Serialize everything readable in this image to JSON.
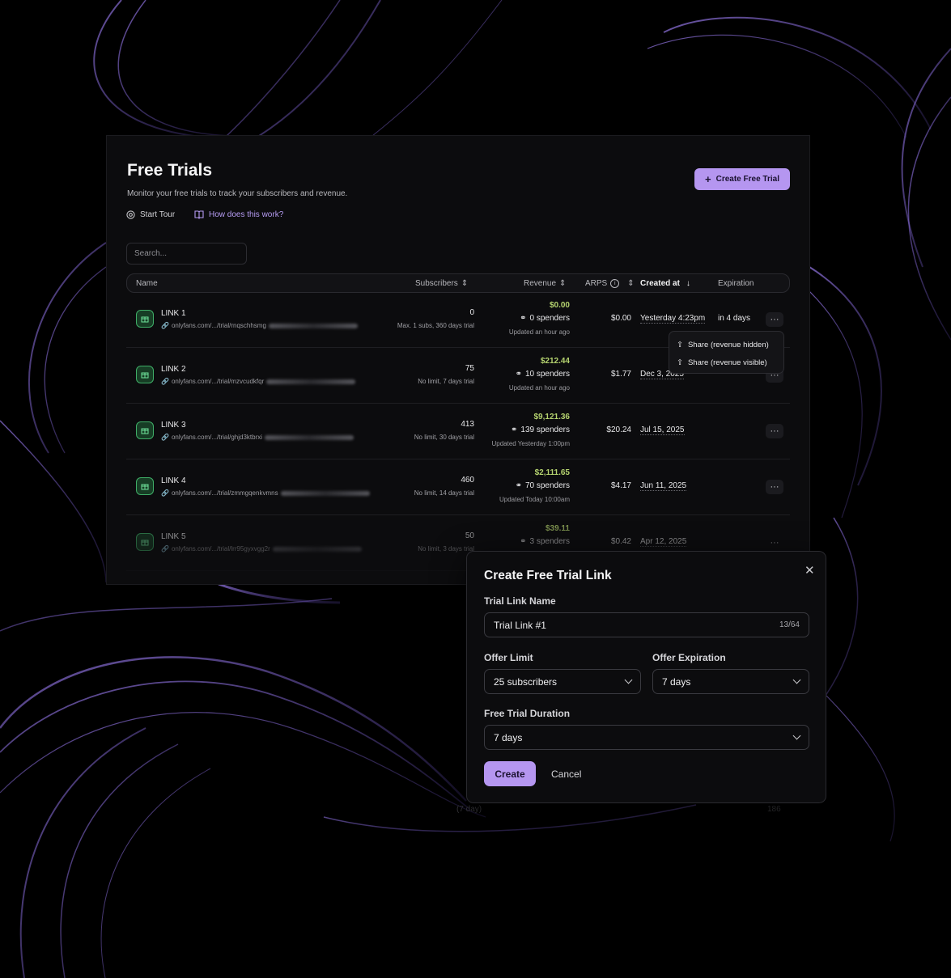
{
  "page": {
    "title": "Free Trials",
    "subtitle": "Monitor your free trials to track your subscribers and revenue.",
    "start_tour": "Start Tour",
    "how_it_works": "How does this work?",
    "create_button": "Create Free Trial",
    "search_placeholder": "Search..."
  },
  "table": {
    "columns": {
      "name": "Name",
      "subscribers": "Subscribers",
      "revenue": "Revenue",
      "arps": "ARPS",
      "created_at": "Created at",
      "expiration": "Expiration"
    },
    "rows": [
      {
        "name": "LINK 1",
        "url": "onlyfans.com/.../trial/rnqschhsmg",
        "subscribers": "0",
        "subs_note": "Max. 1 subs, 360 days trial",
        "revenue": "$0.00",
        "spenders": "0 spenders",
        "updated": "Updated an hour ago",
        "arps": "$0.00",
        "created": "Yesterday 4:23pm",
        "expiration": "in 4 days"
      },
      {
        "name": "LINK 2",
        "url": "onlyfans.com/.../trial/mzvcudkfqr",
        "subscribers": "75",
        "subs_note": "No limit, 7 days trial",
        "revenue": "$212.44",
        "spenders": "10 spenders",
        "updated": "Updated an hour ago",
        "arps": "$1.77",
        "created": "Dec 3, 2025",
        "expiration": ""
      },
      {
        "name": "LINK 3",
        "url": "onlyfans.com/.../trial/ghjd3ktbrxi",
        "subscribers": "413",
        "subs_note": "No limit, 30 days trial",
        "revenue": "$9,121.36",
        "spenders": "139 spenders",
        "updated": "Updated Yesterday 1:00pm",
        "arps": "$20.24",
        "created": "Jul 15, 2025",
        "expiration": ""
      },
      {
        "name": "LINK 4",
        "url": "onlyfans.com/.../trial/zmmgqenkvmns",
        "subscribers": "460",
        "subs_note": "No limit, 14 days trial",
        "revenue": "$2,111.65",
        "spenders": "70 spenders",
        "updated": "Updated Today 10:00am",
        "arps": "$4.17",
        "created": "Jun 11, 2025",
        "expiration": ""
      },
      {
        "name": "LINK 5",
        "url": "onlyfans.com/.../trial/lrr95gyxvgg2r",
        "subscribers": "50",
        "subs_note": "No limit, 3 days trial",
        "revenue": "$39.11",
        "spenders": "3 spenders",
        "updated": "",
        "arps": "$0.42",
        "created": "Apr 12, 2025",
        "expiration": ""
      }
    ]
  },
  "context_menu": {
    "share_hidden": "Share (revenue hidden)",
    "share_visible": "Share (revenue visible)"
  },
  "behind_modal": {
    "trial": "(7 day)",
    "count": "186"
  },
  "modal": {
    "title": "Create Free Trial Link",
    "name_label": "Trial Link Name",
    "name_value": "Trial Link #1",
    "name_counter": "13/64",
    "offer_limit_label": "Offer Limit",
    "offer_limit_value": "25 subscribers",
    "offer_expiration_label": "Offer Expiration",
    "offer_expiration_value": "7 days",
    "duration_label": "Free Trial Duration",
    "duration_value": "7 days",
    "create": "Create",
    "cancel": "Cancel"
  },
  "colors": {
    "accent": "#b596f0",
    "revenue_green": "#b5d36f",
    "link_icon_green": "#3fae67",
    "background": "#000000",
    "panel": "#0c0c0e"
  }
}
